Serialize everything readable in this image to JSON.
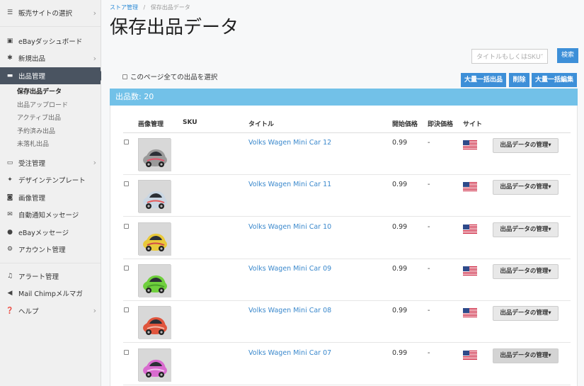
{
  "sidebar": {
    "items": [
      {
        "label": "販売サイトの選択",
        "icon": "menu-icon"
      },
      {
        "label": "eBayダッシュボード",
        "icon": "dashboard-icon"
      },
      {
        "label": "新規出品",
        "icon": "asterisk-icon"
      },
      {
        "label": "出品管理",
        "icon": "folder-icon"
      },
      {
        "label": "受注管理",
        "icon": "inbox-icon"
      },
      {
        "label": "デザインテンプレート",
        "icon": "stars-icon"
      },
      {
        "label": "画像管理",
        "icon": "camera-icon"
      },
      {
        "label": "自動通知メッセージ",
        "icon": "envelope-icon"
      },
      {
        "label": "eBayメッセージ",
        "icon": "comment-icon"
      },
      {
        "label": "アカウント管理",
        "icon": "cogs-icon"
      },
      {
        "label": "アラート管理",
        "icon": "bell-icon"
      },
      {
        "label": "Mail Chimpメルマガ",
        "icon": "send-icon"
      },
      {
        "label": "ヘルプ",
        "icon": "question-icon"
      }
    ],
    "sub_items": [
      "保存出品データ",
      "出品アップロード",
      "アクティブ出品",
      "予約済み出品",
      "未落札出品"
    ]
  },
  "breadcrumb": {
    "root": "ストア管理",
    "separator": "/",
    "current": "保存出品データ"
  },
  "page_title": "保存出品データ",
  "search": {
    "placeholder": "タイトルもしくはSKUで",
    "button": "検索"
  },
  "select_all_label": "このページ全ての出品を選択",
  "bulk": {
    "listing": "大量一括出品",
    "delete": "削除",
    "edit": "大量一括編集"
  },
  "count_label": "出品数: 20",
  "columns": {
    "image": "画像管理",
    "sku": "SKU",
    "title": "タイトル",
    "start_price": "開始価格",
    "buy_now": "即決価格",
    "site": "サイト"
  },
  "rows": [
    {
      "title": "Volks Wagen Mini Car 12",
      "price": "0.99",
      "buy_now": "-",
      "manage": "出品データの管理▾",
      "car_color": "#9a9a9a",
      "car_accent": "#e0546b"
    },
    {
      "title": "Volks Wagen Mini Car 11",
      "price": "0.99",
      "buy_now": "-",
      "manage": "出品データの管理▾",
      "car_color": "#c9d6e3",
      "car_accent": "#e65a5a"
    },
    {
      "title": "Volks Wagen Mini Car 10",
      "price": "0.99",
      "buy_now": "-",
      "manage": "出品データの管理▾",
      "car_color": "#e9c93a",
      "car_accent": "#d14a4a"
    },
    {
      "title": "Volks Wagen Mini Car 09",
      "price": "0.99",
      "buy_now": "-",
      "manage": "出品データの管理▾",
      "car_color": "#6fcf3d",
      "car_accent": "#4aa02a"
    },
    {
      "title": "Volks Wagen Mini Car 08",
      "price": "0.99",
      "buy_now": "-",
      "manage": "出品データの管理▾",
      "car_color": "#e0553d",
      "car_accent": "#f2b8a8"
    },
    {
      "title": "Volks Wagen Mini Car 07",
      "price": "0.99",
      "buy_now": "-",
      "manage": "出品データの管理▾",
      "car_color": "#d96bcf",
      "car_accent": "#f3c6ef"
    }
  ],
  "colors": {
    "accent": "#3d8fd8",
    "count_bar": "#72c1e8",
    "sidebar_active": "#4a5461"
  }
}
